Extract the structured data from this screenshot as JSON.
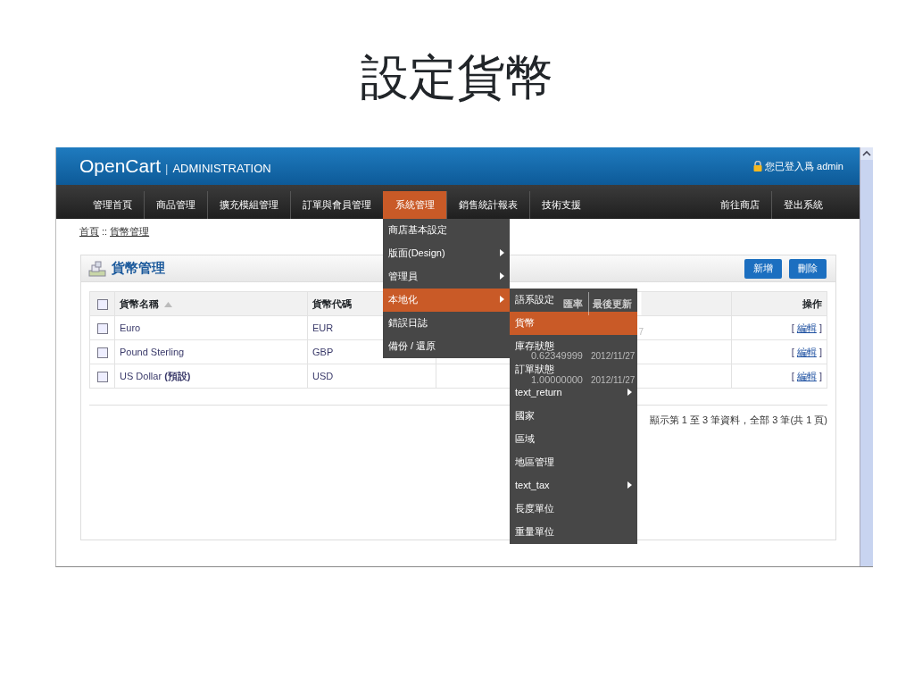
{
  "slide_title": "設定貨幣",
  "header": {
    "logo": "OpenCart",
    "separator": "|",
    "subtitle": "ADMINISTRATION",
    "login": "您已登入爲 admin"
  },
  "nav": {
    "left": [
      {
        "label": "管理首頁",
        "selected": false
      },
      {
        "label": "商品管理",
        "selected": false
      },
      {
        "label": "擴充模組管理",
        "selected": false
      },
      {
        "label": "訂單與會員管理",
        "selected": false
      },
      {
        "label": "系統管理",
        "selected": true
      },
      {
        "label": "銷售統計報表",
        "selected": false
      },
      {
        "label": "技術支援",
        "selected": false
      }
    ],
    "right": [
      {
        "label": "前往商店"
      },
      {
        "label": "登出系統"
      }
    ]
  },
  "menu": [
    {
      "label": "商店基本設定",
      "submenu": false,
      "selected": false
    },
    {
      "label": "版面(Design)",
      "submenu": true,
      "selected": false
    },
    {
      "label": "管理員",
      "submenu": true,
      "selected": false
    },
    {
      "label": "本地化",
      "submenu": true,
      "selected": true
    },
    {
      "label": "錯誤日誌",
      "submenu": false,
      "selected": false
    },
    {
      "label": "備份 / 還原",
      "submenu": false,
      "selected": false
    }
  ],
  "submenu": [
    {
      "label": "語系設定",
      "submenu": false,
      "selected": false
    },
    {
      "label": "貨幣",
      "submenu": false,
      "selected": true
    },
    {
      "label": "庫存狀態",
      "submenu": false,
      "selected": false
    },
    {
      "label": "訂單狀態",
      "submenu": false,
      "selected": false
    },
    {
      "label": "text_return",
      "submenu": true,
      "selected": false
    },
    {
      "label": "國家",
      "submenu": false,
      "selected": false
    },
    {
      "label": "區域",
      "submenu": false,
      "selected": false
    },
    {
      "label": "地區管理",
      "submenu": false,
      "selected": false
    },
    {
      "label": "text_tax",
      "submenu": true,
      "selected": false
    },
    {
      "label": "長度單位",
      "submenu": false,
      "selected": false
    },
    {
      "label": "重量單位",
      "submenu": false,
      "selected": false
    }
  ],
  "breadcrumb": {
    "items": [
      "首頁",
      "貨幣管理"
    ],
    "separator": "::"
  },
  "panel": {
    "title": "貨幣管理",
    "buttons": [
      "新增",
      "刪除"
    ]
  },
  "table": {
    "all_checked": false,
    "columns": [
      {
        "label": "貨幣名稱",
        "sorted": true
      },
      {
        "label": "貨幣代碼",
        "sorted": false
      },
      {
        "label": "匯率",
        "sorted": false
      },
      {
        "label": "最後更新",
        "sorted": false
      },
      {
        "label": "操作",
        "sorted": false
      }
    ],
    "rows": [
      {
        "checked": false,
        "cells": [
          "Euro",
          "EUR",
          "",
          "7"
        ],
        "action": {
          "open": "[",
          "link": "編輯",
          "close": "]"
        }
      },
      {
        "checked": false,
        "cells": [
          "Pound Sterling",
          "GBP",
          "0.62349999",
          "2012/11/27"
        ],
        "action": {
          "open": "[",
          "link": "編輯",
          "close": "]"
        }
      },
      {
        "checked": false,
        "cells": [
          "US Dollar **(預設)**",
          "USD",
          "1.00000000",
          "2012/11/27"
        ],
        "action": {
          "open": "[",
          "link": "編輯",
          "close": "]"
        }
      }
    ]
  },
  "pagination": "顯示第 1 至 3 筆資料，全部 3 筆(共 1 頁)"
}
